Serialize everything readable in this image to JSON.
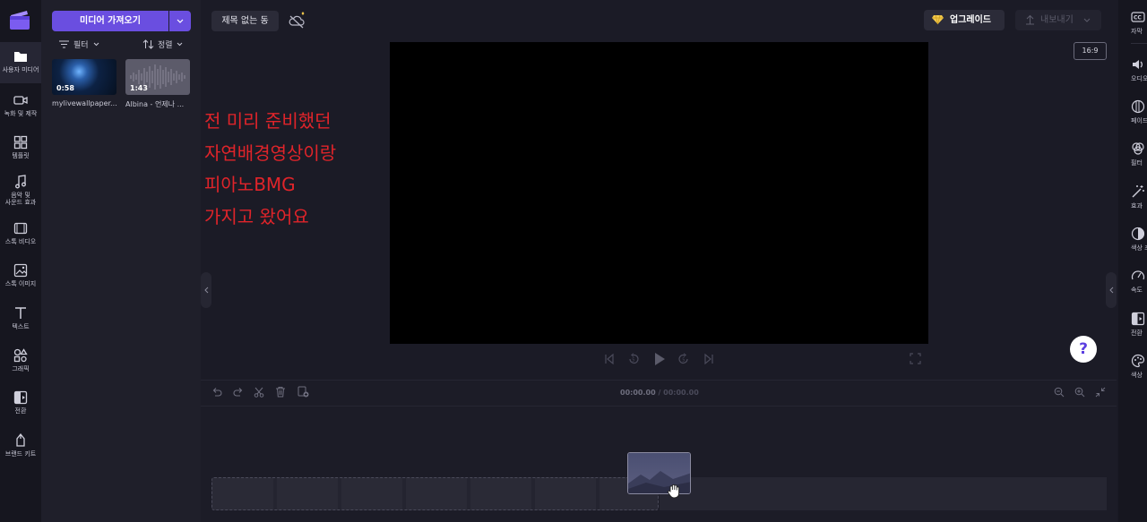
{
  "left_rail": {
    "items": [
      {
        "label": "사용자 미디어",
        "icon": "folder-icon"
      },
      {
        "label": "녹화 및 제작",
        "icon": "video-camera-icon"
      },
      {
        "label": "템플릿",
        "icon": "templates-icon"
      },
      {
        "label": "음악 및 사운드 효과",
        "icon": "music-note-icon"
      },
      {
        "label": "스톡 비디오",
        "icon": "film-icon"
      },
      {
        "label": "스톡 이미지",
        "icon": "image-icon"
      },
      {
        "label": "텍스트",
        "icon": "text-icon"
      },
      {
        "label": "그래픽",
        "icon": "shapes-icon"
      },
      {
        "label": "전환",
        "icon": "transition-icon"
      },
      {
        "label": "브랜드 키트",
        "icon": "brand-kit-icon"
      }
    ]
  },
  "media_panel": {
    "import_label": "미디어 가져오기",
    "filter_label": "필터",
    "sort_label": "정렬",
    "items": [
      {
        "name": "mylivewallpaper...",
        "duration": "0:58"
      },
      {
        "name": "Albina - 언제나 ...",
        "duration": "1:43"
      }
    ]
  },
  "header": {
    "title": "제목 없는 동",
    "upgrade_label": "업그레이드",
    "export_label": "내보내기",
    "aspect_ratio": "16:9"
  },
  "overlay_text": [
    "전 미리 준비했던",
    "자연배경영상이랑",
    "피아노BMG",
    "가지고 왔어요"
  ],
  "timeline": {
    "timecode_current": "00:00.00",
    "timecode_total": "/ 00:00.00"
  },
  "right_rail": {
    "items": [
      {
        "label": "자막",
        "icon": "captions-icon"
      },
      {
        "label": "오디오",
        "icon": "speaker-icon"
      },
      {
        "label": "페이드",
        "icon": "fade-icon"
      },
      {
        "label": "필터",
        "icon": "filter-icon"
      },
      {
        "label": "효과",
        "icon": "magic-wand-icon"
      },
      {
        "label": "색상 조",
        "icon": "color-adjust-icon"
      },
      {
        "label": "속도",
        "icon": "speedometer-icon"
      },
      {
        "label": "전환",
        "icon": "transition-icon"
      },
      {
        "label": "색상",
        "icon": "palette-icon"
      }
    ]
  },
  "help_label": "?"
}
